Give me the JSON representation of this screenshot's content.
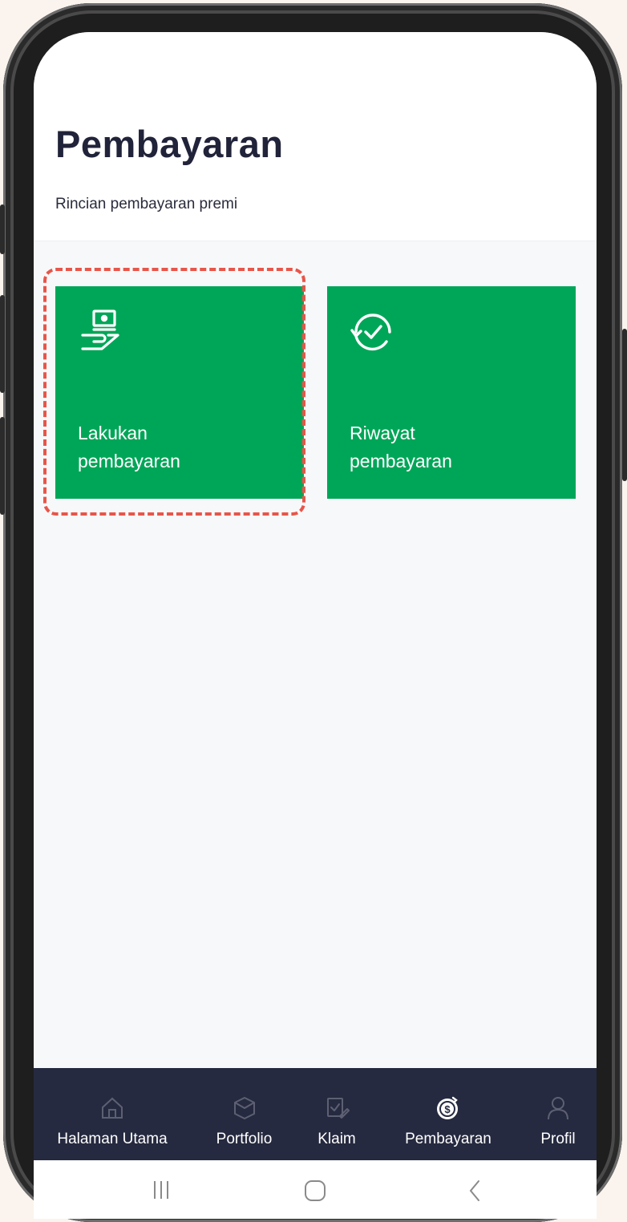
{
  "header": {
    "title": "Pembayaran",
    "subtitle": "Rincian pembayaran premi"
  },
  "tiles": [
    {
      "label_line1": "Lakukan",
      "label_line2": "pembayaran",
      "icon": "hand-cash-icon"
    },
    {
      "label_line1": "Riwayat",
      "label_line2": "pembayaran",
      "icon": "history-check-icon"
    }
  ],
  "bottom_nav": {
    "items": [
      {
        "label": "Halaman Utama",
        "icon": "home-icon",
        "active": false
      },
      {
        "label": "Portfolio",
        "icon": "box-icon",
        "active": false
      },
      {
        "label": "Klaim",
        "icon": "claim-icon",
        "active": false
      },
      {
        "label": "Pembayaran",
        "icon": "payment-icon",
        "active": true
      },
      {
        "label": "Profil",
        "icon": "person-icon",
        "active": false
      }
    ]
  },
  "system_nav": {
    "icons": [
      "recent-apps-icon",
      "home-button-icon",
      "back-icon"
    ]
  },
  "colors": {
    "accent": "#00a658",
    "nav_background": "#262a40",
    "highlight": "#e8554a",
    "background": "#f7f8f9"
  }
}
